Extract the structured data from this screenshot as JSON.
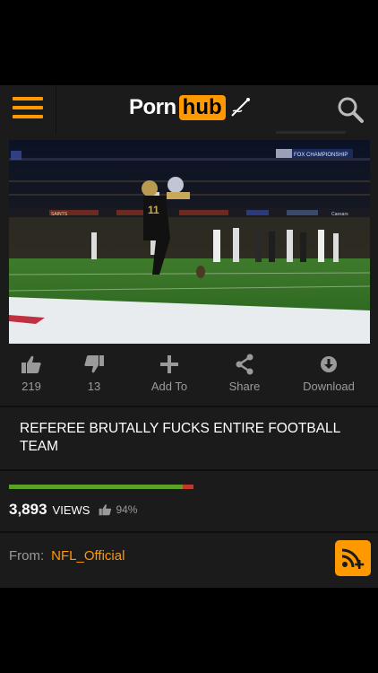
{
  "header": {
    "logo_left": "Porn",
    "logo_right": "hub"
  },
  "video": {
    "score_bug": "FOX CHAMPIONSHIP",
    "board_text": "SAINTS",
    "board_text_2": "Caesars"
  },
  "actions": [
    {
      "label": "219",
      "icon": "thumbs-up-icon"
    },
    {
      "label": "13",
      "icon": "thumbs-down-icon"
    },
    {
      "label": "Add To",
      "icon": "plus-icon"
    },
    {
      "label": "Share",
      "icon": "share-icon"
    },
    {
      "label": "Download",
      "icon": "download-icon"
    }
  ],
  "title": "REFEREE BRUTALLY FUCKS ENTIRE FOOTBALL TEAM",
  "stats": {
    "views_count": "3,893",
    "views_label": "VIEWS",
    "rating_percent": "94%",
    "rating_fraction": 0.94
  },
  "uploader": {
    "from_label": "From:",
    "name": "NFL_Official"
  },
  "colors": {
    "accent": "#ff9900",
    "background": "#1b1b1b",
    "rating_good": "#5ba229",
    "rating_bad": "#c0392b"
  }
}
